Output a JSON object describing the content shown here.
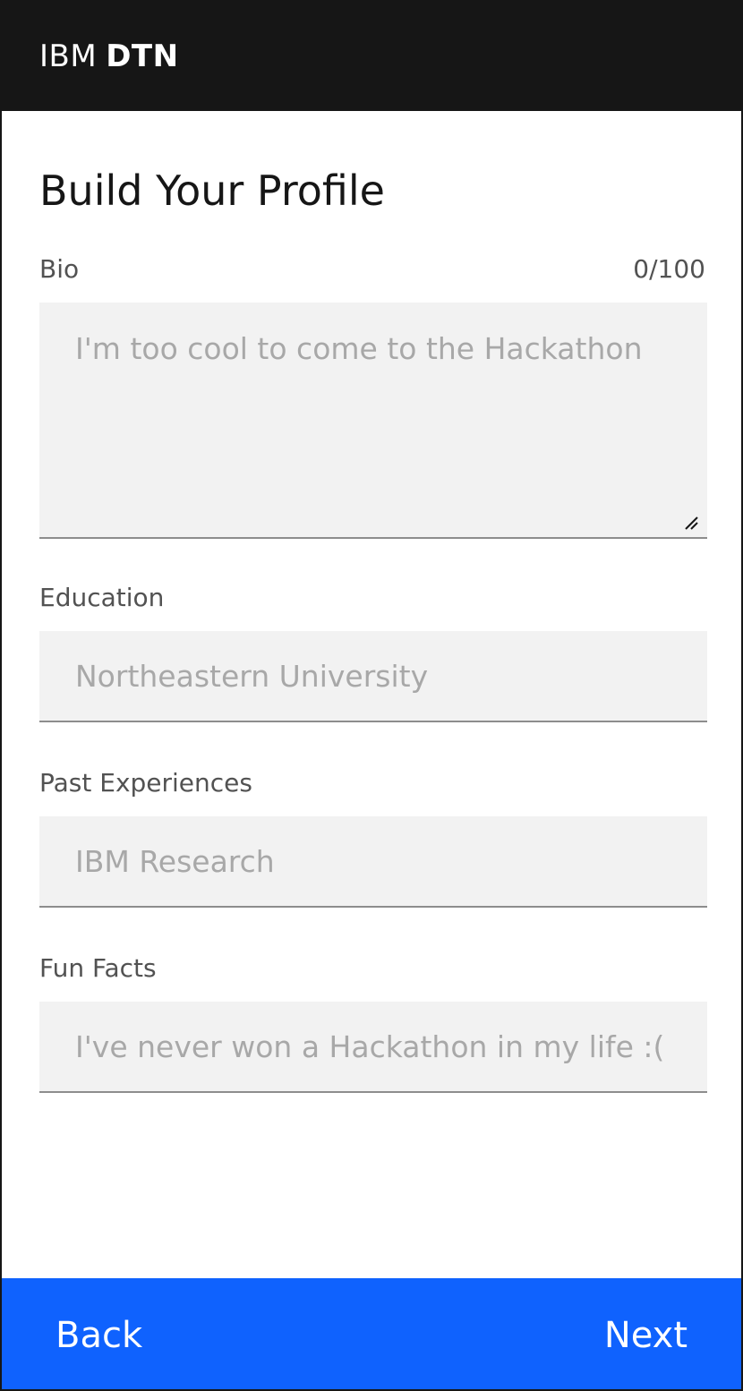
{
  "header": {
    "brand_light": "IBM",
    "brand_bold": "DTN"
  },
  "page_title": "Build Your Profile",
  "bio": {
    "label": "Bio",
    "counter": "0/100",
    "placeholder": "I'm too cool to come to the Hackathon",
    "value": ""
  },
  "education": {
    "label": "Education",
    "placeholder": "Northeastern University",
    "value": ""
  },
  "past_experiences": {
    "label": "Past Experiences",
    "placeholder": "IBM Research",
    "value": ""
  },
  "fun_facts": {
    "label": "Fun Facts",
    "placeholder": "I've never won a Hackathon in my life :(",
    "value": ""
  },
  "footer": {
    "back_label": "Back",
    "next_label": "Next"
  },
  "colors": {
    "header_bg": "#161616",
    "footer_bg": "#0f62fe",
    "field_bg": "#f2f2f2"
  }
}
